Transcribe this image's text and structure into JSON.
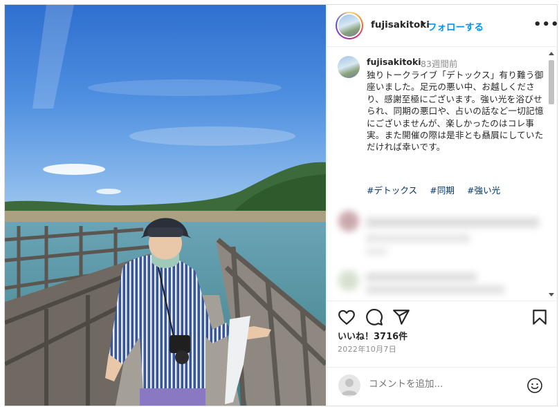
{
  "post": {
    "username": "fujisakitoki",
    "separator": "•",
    "follow_label": "フォローする",
    "more_label": "•••",
    "caption_user": "fujisakitoki",
    "caption_time": "83週間前",
    "caption_text": "独りトークライブ「デトックス」有り難う御座いました。足元の悪い中、お越しくださり、感謝至極にございます。強い光を浴びせられ、同期の悪口や、占いの話など一切記憶にございませんが、楽しかったのはコレ事実。また開催の際は是非とも贔屓にしていただければ幸いです。",
    "hashtags": [
      "#デトックス",
      "#同期",
      "#強い光"
    ],
    "likes_text": "いいね！3716件",
    "date_text": "2022年10月7日",
    "comment_placeholder": "コメントを追加..."
  },
  "icons": {
    "like": "heart-icon",
    "comment": "comment-icon",
    "share": "send-icon",
    "save": "bookmark-icon",
    "emoji": "emoji-icon"
  },
  "colors": {
    "follow_blue": "#0095f6",
    "hashtag": "#00376b",
    "muted": "#8e8e8e"
  }
}
